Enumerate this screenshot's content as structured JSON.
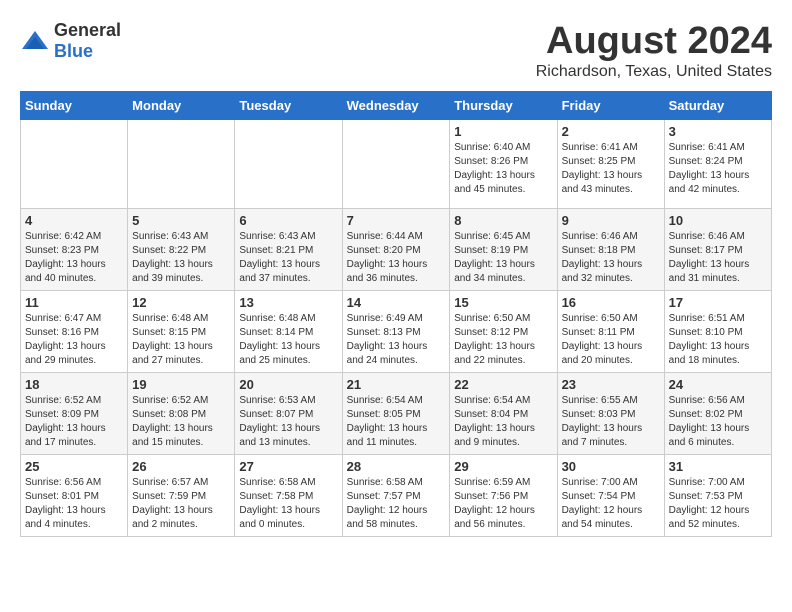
{
  "logo": {
    "general": "General",
    "blue": "Blue"
  },
  "title": "August 2024",
  "subtitle": "Richardson, Texas, United States",
  "days_of_week": [
    "Sunday",
    "Monday",
    "Tuesday",
    "Wednesday",
    "Thursday",
    "Friday",
    "Saturday"
  ],
  "weeks": [
    [
      {
        "day": "",
        "info": ""
      },
      {
        "day": "",
        "info": ""
      },
      {
        "day": "",
        "info": ""
      },
      {
        "day": "",
        "info": ""
      },
      {
        "day": "1",
        "info": "Sunrise: 6:40 AM\nSunset: 8:26 PM\nDaylight: 13 hours\nand 45 minutes."
      },
      {
        "day": "2",
        "info": "Sunrise: 6:41 AM\nSunset: 8:25 PM\nDaylight: 13 hours\nand 43 minutes."
      },
      {
        "day": "3",
        "info": "Sunrise: 6:41 AM\nSunset: 8:24 PM\nDaylight: 13 hours\nand 42 minutes."
      }
    ],
    [
      {
        "day": "4",
        "info": "Sunrise: 6:42 AM\nSunset: 8:23 PM\nDaylight: 13 hours\nand 40 minutes."
      },
      {
        "day": "5",
        "info": "Sunrise: 6:43 AM\nSunset: 8:22 PM\nDaylight: 13 hours\nand 39 minutes."
      },
      {
        "day": "6",
        "info": "Sunrise: 6:43 AM\nSunset: 8:21 PM\nDaylight: 13 hours\nand 37 minutes."
      },
      {
        "day": "7",
        "info": "Sunrise: 6:44 AM\nSunset: 8:20 PM\nDaylight: 13 hours\nand 36 minutes."
      },
      {
        "day": "8",
        "info": "Sunrise: 6:45 AM\nSunset: 8:19 PM\nDaylight: 13 hours\nand 34 minutes."
      },
      {
        "day": "9",
        "info": "Sunrise: 6:46 AM\nSunset: 8:18 PM\nDaylight: 13 hours\nand 32 minutes."
      },
      {
        "day": "10",
        "info": "Sunrise: 6:46 AM\nSunset: 8:17 PM\nDaylight: 13 hours\nand 31 minutes."
      }
    ],
    [
      {
        "day": "11",
        "info": "Sunrise: 6:47 AM\nSunset: 8:16 PM\nDaylight: 13 hours\nand 29 minutes."
      },
      {
        "day": "12",
        "info": "Sunrise: 6:48 AM\nSunset: 8:15 PM\nDaylight: 13 hours\nand 27 minutes."
      },
      {
        "day": "13",
        "info": "Sunrise: 6:48 AM\nSunset: 8:14 PM\nDaylight: 13 hours\nand 25 minutes."
      },
      {
        "day": "14",
        "info": "Sunrise: 6:49 AM\nSunset: 8:13 PM\nDaylight: 13 hours\nand 24 minutes."
      },
      {
        "day": "15",
        "info": "Sunrise: 6:50 AM\nSunset: 8:12 PM\nDaylight: 13 hours\nand 22 minutes."
      },
      {
        "day": "16",
        "info": "Sunrise: 6:50 AM\nSunset: 8:11 PM\nDaylight: 13 hours\nand 20 minutes."
      },
      {
        "day": "17",
        "info": "Sunrise: 6:51 AM\nSunset: 8:10 PM\nDaylight: 13 hours\nand 18 minutes."
      }
    ],
    [
      {
        "day": "18",
        "info": "Sunrise: 6:52 AM\nSunset: 8:09 PM\nDaylight: 13 hours\nand 17 minutes."
      },
      {
        "day": "19",
        "info": "Sunrise: 6:52 AM\nSunset: 8:08 PM\nDaylight: 13 hours\nand 15 minutes."
      },
      {
        "day": "20",
        "info": "Sunrise: 6:53 AM\nSunset: 8:07 PM\nDaylight: 13 hours\nand 13 minutes."
      },
      {
        "day": "21",
        "info": "Sunrise: 6:54 AM\nSunset: 8:05 PM\nDaylight: 13 hours\nand 11 minutes."
      },
      {
        "day": "22",
        "info": "Sunrise: 6:54 AM\nSunset: 8:04 PM\nDaylight: 13 hours\nand 9 minutes."
      },
      {
        "day": "23",
        "info": "Sunrise: 6:55 AM\nSunset: 8:03 PM\nDaylight: 13 hours\nand 7 minutes."
      },
      {
        "day": "24",
        "info": "Sunrise: 6:56 AM\nSunset: 8:02 PM\nDaylight: 13 hours\nand 6 minutes."
      }
    ],
    [
      {
        "day": "25",
        "info": "Sunrise: 6:56 AM\nSunset: 8:01 PM\nDaylight: 13 hours\nand 4 minutes."
      },
      {
        "day": "26",
        "info": "Sunrise: 6:57 AM\nSunset: 7:59 PM\nDaylight: 13 hours\nand 2 minutes."
      },
      {
        "day": "27",
        "info": "Sunrise: 6:58 AM\nSunset: 7:58 PM\nDaylight: 13 hours\nand 0 minutes."
      },
      {
        "day": "28",
        "info": "Sunrise: 6:58 AM\nSunset: 7:57 PM\nDaylight: 12 hours\nand 58 minutes."
      },
      {
        "day": "29",
        "info": "Sunrise: 6:59 AM\nSunset: 7:56 PM\nDaylight: 12 hours\nand 56 minutes."
      },
      {
        "day": "30",
        "info": "Sunrise: 7:00 AM\nSunset: 7:54 PM\nDaylight: 12 hours\nand 54 minutes."
      },
      {
        "day": "31",
        "info": "Sunrise: 7:00 AM\nSunset: 7:53 PM\nDaylight: 12 hours\nand 52 minutes."
      }
    ]
  ]
}
